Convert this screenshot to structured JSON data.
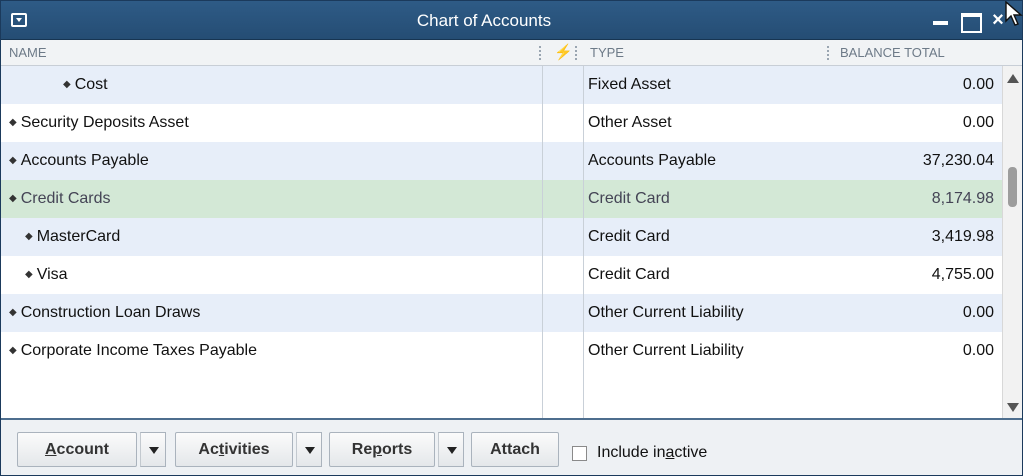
{
  "window": {
    "title": "Chart of Accounts",
    "close_glyph": "×",
    "icons": {
      "system_menu": "window-menu-icon",
      "minimize": "minimize-icon",
      "maximize": "maximize-icon",
      "close": "close-icon"
    }
  },
  "columns": {
    "name": "NAME",
    "type": "TYPE",
    "balance": "BALANCE TOTAL",
    "reconcile_icon_glyph": "⚡",
    "reconcile_icon": "reconcile-lightning-icon"
  },
  "rows": [
    {
      "name": "Cost",
      "type": "Fixed Asset",
      "balance": "0.00",
      "level": 2,
      "state": "alt"
    },
    {
      "name": "Security Deposits Asset",
      "type": "Other Asset",
      "balance": "0.00",
      "level": 0,
      "state": "plain"
    },
    {
      "name": "Accounts Payable",
      "type": "Accounts Payable",
      "balance": "37,230.04",
      "level": 0,
      "state": "alt"
    },
    {
      "name": "Credit Cards",
      "type": "Credit Card",
      "balance": "8,174.98",
      "level": 0,
      "state": "selected"
    },
    {
      "name": "MasterCard",
      "type": "Credit Card",
      "balance": "3,419.98",
      "level": 1,
      "state": "alt"
    },
    {
      "name": "Visa",
      "type": "Credit Card",
      "balance": "4,755.00",
      "level": 1,
      "state": "plain"
    },
    {
      "name": "Construction Loan Draws",
      "type": "Other Current Liability",
      "balance": "0.00",
      "level": 0,
      "state": "alt"
    },
    {
      "name": "Corporate Income Taxes Payable",
      "type": "Other Current Liability",
      "balance": "0.00",
      "level": 0,
      "state": "plain"
    }
  ],
  "row_bullet": "◆",
  "footer": {
    "account": {
      "pre": "",
      "u": "A",
      "post": "ccount"
    },
    "activities": {
      "pre": "Ac",
      "u": "t",
      "post": "ivities"
    },
    "reports": {
      "pre": "Re",
      "u": "p",
      "post": "orts"
    },
    "attach": "Attach",
    "include_inactive": {
      "pre": "Include in",
      "u": "a",
      "post": "ctive"
    },
    "include_inactive_checked": false
  },
  "colors": {
    "title_bar": "#2e5b86",
    "row_alt": "#e7eef9",
    "row_selected": "#d3e8d6"
  }
}
